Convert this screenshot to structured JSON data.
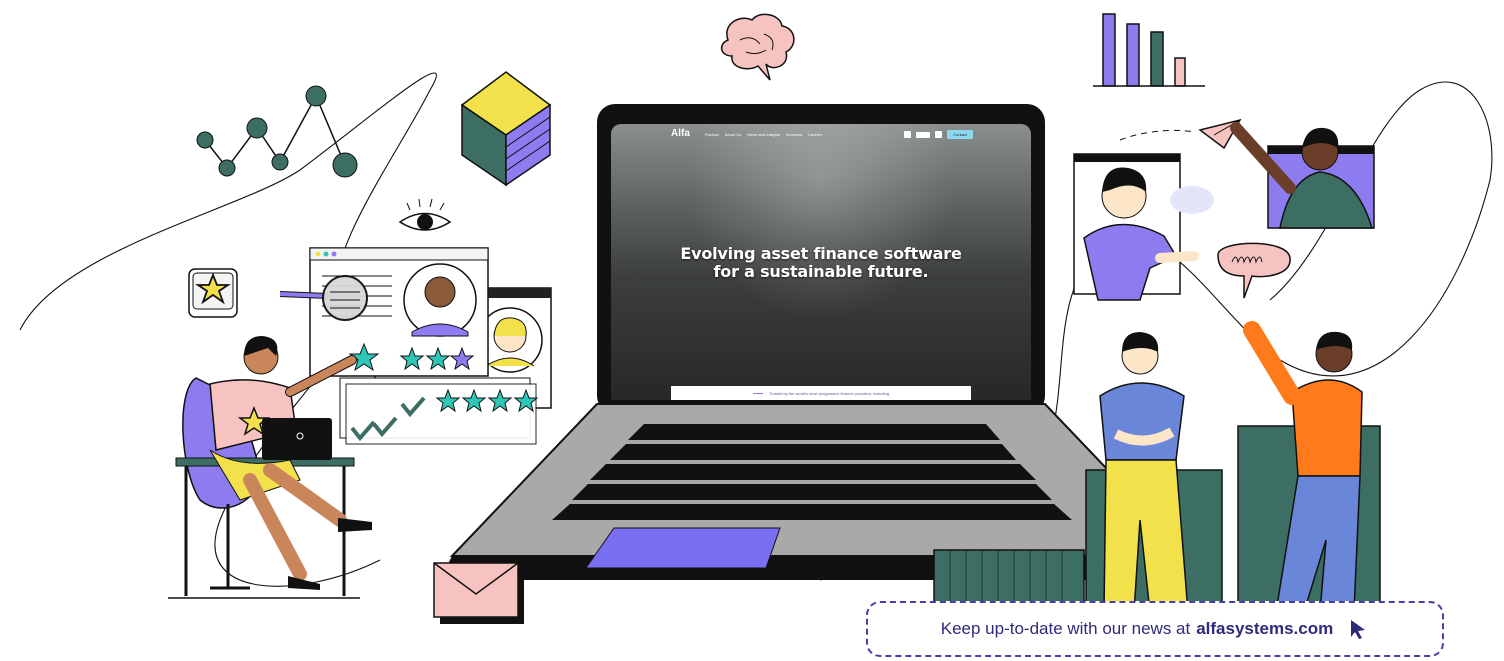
{
  "laptop_screen": {
    "logo": "Alfa",
    "nav_items": [
      "Product",
      "About Us",
      "News and Insights",
      "Investors",
      "Careers"
    ],
    "contact_label": "Contact",
    "hero_title_line1": "Evolving asset finance software",
    "hero_title_line2": "for a sustainable future.",
    "trusted_text": "Trusted by the world's most progressive finance providers, including"
  },
  "banner": {
    "text": "Keep up-to-date with our news at",
    "link": "alfasystems.com"
  },
  "icons": [
    "star-icon",
    "eye-icon",
    "brain-icon",
    "bar-chart-icon",
    "paper-plane-icon",
    "speech-bubble-icon",
    "envelope-icon",
    "cursor-icon",
    "magnifier-icon"
  ],
  "colors": {
    "purple": "#8c7cf0",
    "dark_green": "#3d6e63",
    "teal": "#2fc6b8",
    "pink": "#f7c3c0",
    "yellow": "#f2e14a",
    "orange": "#ff7a1a",
    "navy_text": "#2f2a7a"
  }
}
